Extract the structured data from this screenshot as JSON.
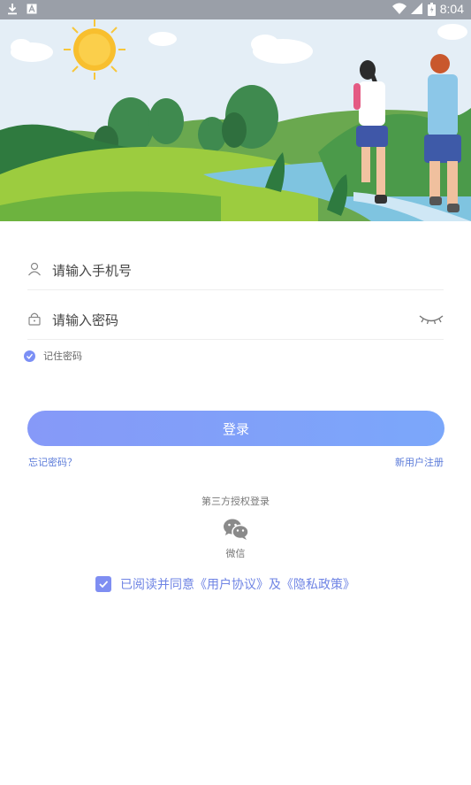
{
  "status_bar": {
    "time": "8:04"
  },
  "login": {
    "phone_placeholder": "请输入手机号",
    "password_placeholder": "请输入密码",
    "remember_label": "记住密码",
    "login_button": "登录",
    "forgot_link": "忘记密码？",
    "register_link": "新用户注册"
  },
  "third_party": {
    "title": "第三方授权登录",
    "wechat_label": "微信"
  },
  "agreement": {
    "prefix": "已阅读并同意",
    "user_agreement": "《用户协议》",
    "connector": "及",
    "privacy_policy": "《隐私政策》"
  },
  "colors": {
    "accent": "#7b8ff5",
    "link": "#5b7bd9",
    "status_bar": "#9a9fa8"
  },
  "icons": [
    "download-icon",
    "a-icon",
    "wifi-icon",
    "signal-icon",
    "battery-icon",
    "user-icon",
    "lock-icon",
    "eye-closed-icon",
    "check-icon",
    "wechat-icon"
  ]
}
